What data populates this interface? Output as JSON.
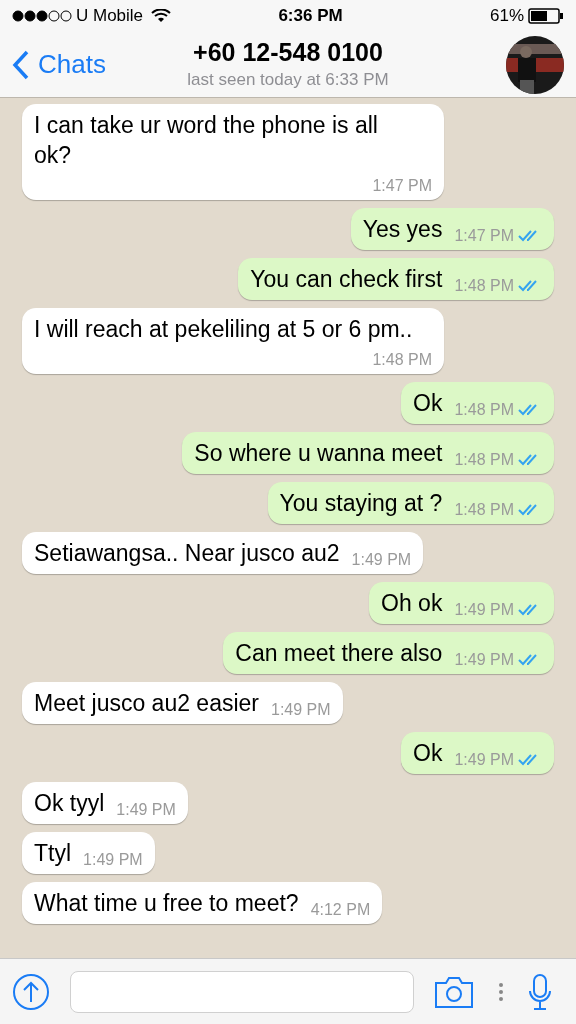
{
  "status_bar": {
    "carrier": "U Mobile",
    "time": "6:36 PM",
    "battery": "61%"
  },
  "header": {
    "back": "Chats",
    "title": "+60 12-548 0100",
    "subtitle": "last seen today at 6:33 PM"
  },
  "messages": [
    {
      "kind": "incoming",
      "text": "I can take ur word the phone is all ok?",
      "time": "1:47 PM"
    },
    {
      "kind": "outgoing",
      "text": "Yes yes",
      "time": "1:47 PM",
      "read": true
    },
    {
      "kind": "outgoing",
      "text": "You can check first",
      "time": "1:48 PM",
      "read": true
    },
    {
      "kind": "incoming",
      "text": "I will reach at pekeliling at 5 or 6 pm..",
      "time": "1:48 PM"
    },
    {
      "kind": "outgoing",
      "text": "Ok",
      "time": "1:48 PM",
      "read": true
    },
    {
      "kind": "outgoing",
      "text": "So where u wanna meet",
      "time": "1:48 PM",
      "read": true
    },
    {
      "kind": "outgoing",
      "text": "You staying at ?",
      "time": "1:48 PM",
      "read": true
    },
    {
      "kind": "incoming",
      "text": "Setiawangsa.. Near jusco au2",
      "time": "1:49 PM"
    },
    {
      "kind": "outgoing",
      "text": "Oh ok",
      "time": "1:49 PM",
      "read": true
    },
    {
      "kind": "outgoing",
      "text": "Can meet there also",
      "time": "1:49 PM",
      "read": true
    },
    {
      "kind": "incoming",
      "text": "Meet jusco au2 easier",
      "time": "1:49 PM"
    },
    {
      "kind": "outgoing",
      "text": "Ok",
      "time": "1:49 PM",
      "read": true
    },
    {
      "kind": "incoming",
      "text": "Ok tyyl",
      "time": "1:49 PM"
    },
    {
      "kind": "incoming",
      "text": "Ttyl",
      "time": "1:49 PM"
    },
    {
      "kind": "incoming",
      "text": "What time u free to meet?",
      "time": "4:12 PM"
    }
  ]
}
